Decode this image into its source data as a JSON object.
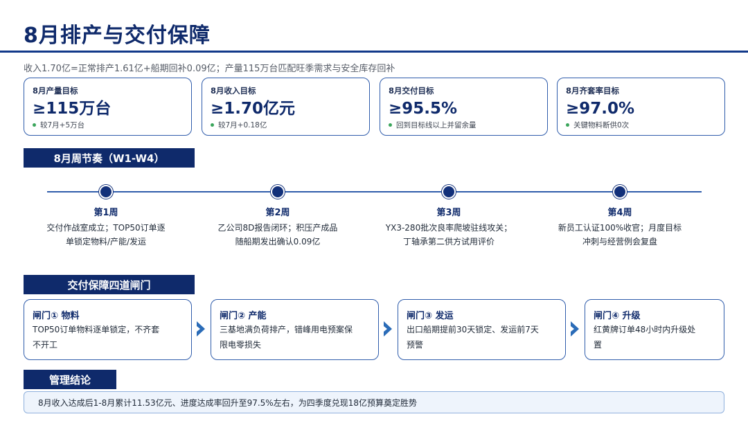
{
  "header": {
    "title": "8月排产与交付保障",
    "subtitle": "收入1.70亿=正常排产1.61亿+船期回补0.09亿；产量115万台匹配旺季需求与安全库存回补"
  },
  "kpis": [
    {
      "label": "8月产量目标",
      "value": "≥115万台",
      "note": "较7月+5万台"
    },
    {
      "label": "8月收入目标",
      "value": "≥1.70亿元",
      "note": "较7月+0.18亿"
    },
    {
      "label": "8月交付目标",
      "value": "≥95.5%",
      "note": "回到目标线以上并留余量"
    },
    {
      "label": "8月齐套率目标",
      "value": "≥97.0%",
      "note": "关键物料断供0次"
    }
  ],
  "rhythm": {
    "section_label": "8月周节奏（W1-W4）",
    "weeks": [
      {
        "title": "第1周",
        "line1": "交付作战室成立；TOP50订单逐",
        "line2": "单锁定物料/产能/发运"
      },
      {
        "title": "第2周",
        "line1": "乙公司8D报告闭环；积压产成品",
        "line2": "随船期发出确认0.09亿"
      },
      {
        "title": "第3周",
        "line1": "YX3-280批次良率爬坡驻线攻关；",
        "line2": "丁轴承第二供方试用评价"
      },
      {
        "title": "第4周",
        "line1": "新员工认证100%收官；月度目标",
        "line2": "冲刺与经营例会复盘"
      }
    ]
  },
  "gates": {
    "section_label": "交付保障四道闸门",
    "items": [
      {
        "title": "闸门① 物料",
        "line1": "TOP50订单物料逐单锁定，不齐套",
        "line2": "不开工"
      },
      {
        "title": "闸门② 产能",
        "line1": "三基地满负荷排产，错峰用电预案保",
        "line2": "限电零损失"
      },
      {
        "title": "闸门③ 发运",
        "line1": "出口船期提前30天锁定、发运前7天",
        "line2": "预警"
      },
      {
        "title": "闸门④ 升级",
        "line1": "红黄牌订单48小时内升级处",
        "line2": "置"
      }
    ]
  },
  "conclusion": {
    "section_label": "管理结论",
    "text": "8月收入达成后1-8月累计11.53亿元、进度达成率回升至97.5%左右，为四季度兑现18亿预算奠定胜势"
  },
  "colors": {
    "brand": "#0f2a6b",
    "accent": "#2f5cab",
    "chevron": "#2b6cb8",
    "status_dot": "#3aa55a"
  }
}
